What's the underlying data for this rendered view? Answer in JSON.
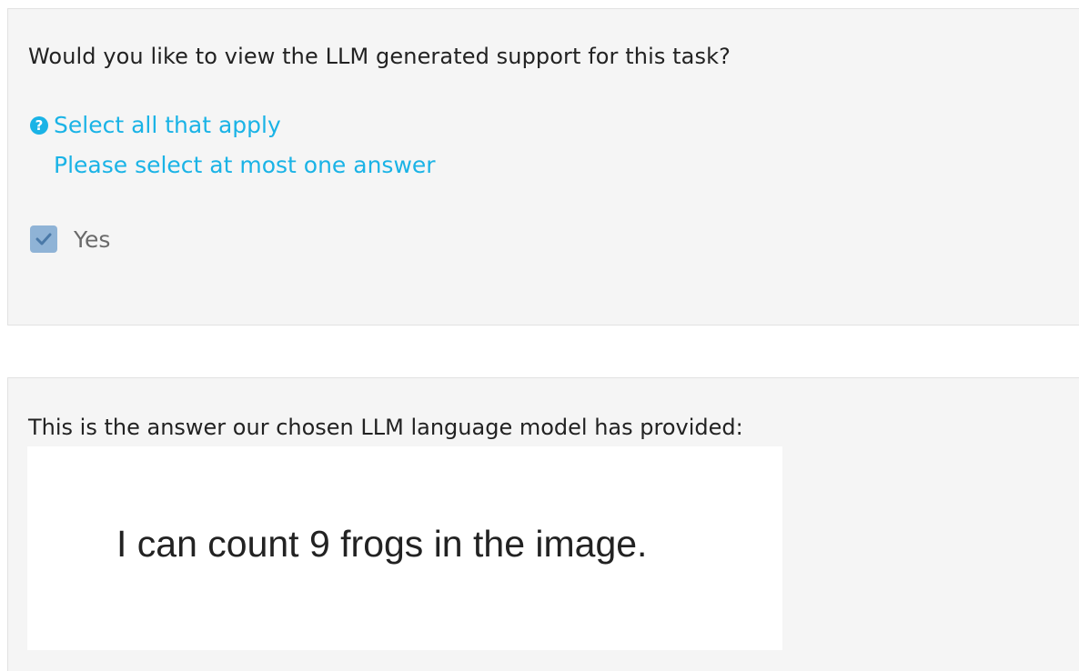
{
  "question_panel": {
    "question": "Would you like to view the LLM generated support for this task?",
    "hint_icon": "question-circle-icon",
    "hint_line_1": "Select all that apply",
    "hint_line_2": "Please select at most one answer",
    "options": [
      {
        "label": "Yes",
        "checked": true
      }
    ]
  },
  "answer_panel": {
    "intro": "This is the answer our chosen LLM language model has provided:",
    "answer": "I can count 9 frogs in the image."
  },
  "colors": {
    "accent": "#1ab3e6",
    "checkbox_fill": "#8fb3d6",
    "panel_bg": "#f5f5f5"
  }
}
